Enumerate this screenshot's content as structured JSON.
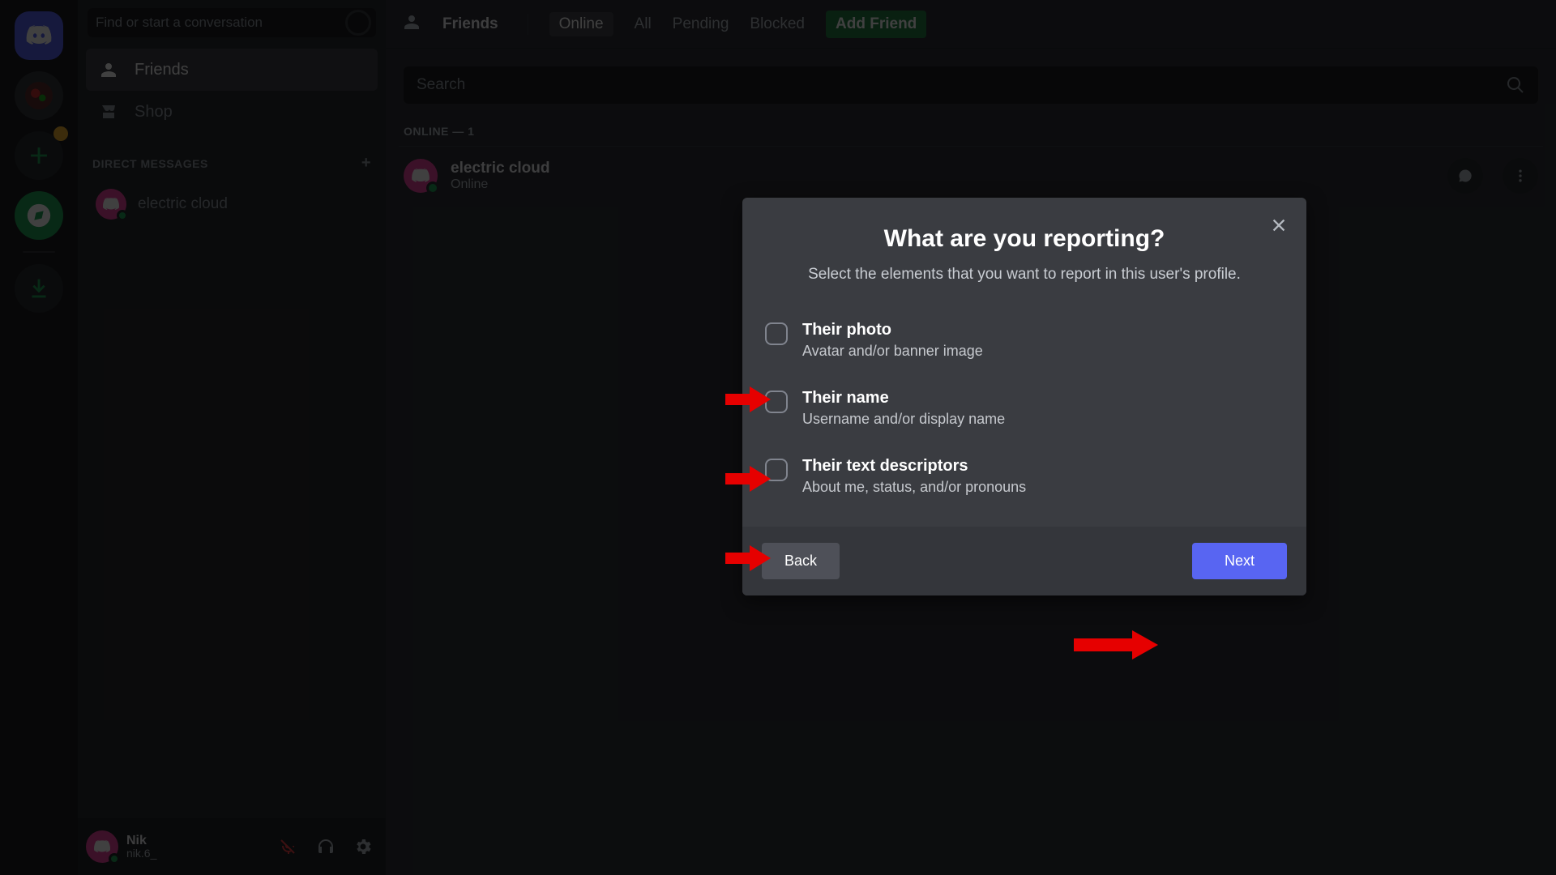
{
  "sidebar": {
    "search_placeholder": "Find or start a conversation",
    "nav": {
      "friends": "Friends",
      "shop": "Shop"
    },
    "dm_heading": "Direct Messages",
    "dm_items": [
      {
        "name": "electric cloud"
      }
    ],
    "user": {
      "name": "Nik",
      "tag": "nik.6_"
    }
  },
  "topbar": {
    "label": "Friends",
    "tabs": {
      "online": "Online",
      "all": "All",
      "pending": "Pending",
      "blocked": "Blocked",
      "add_friend": "Add Friend"
    }
  },
  "search": {
    "placeholder": "Search"
  },
  "friends": {
    "online_heading": "Online — 1",
    "list": [
      {
        "name": "electric cloud",
        "status": "Online"
      }
    ]
  },
  "modal": {
    "title": "What are you reporting?",
    "subtitle": "Select the elements that you want to report in this user's profile.",
    "options": [
      {
        "title": "Their photo",
        "desc": "Avatar and/or banner image"
      },
      {
        "title": "Their name",
        "desc": "Username and/or display name"
      },
      {
        "title": "Their text descriptors",
        "desc": "About me, status, and/or pronouns"
      }
    ],
    "back": "Back",
    "next": "Next"
  }
}
